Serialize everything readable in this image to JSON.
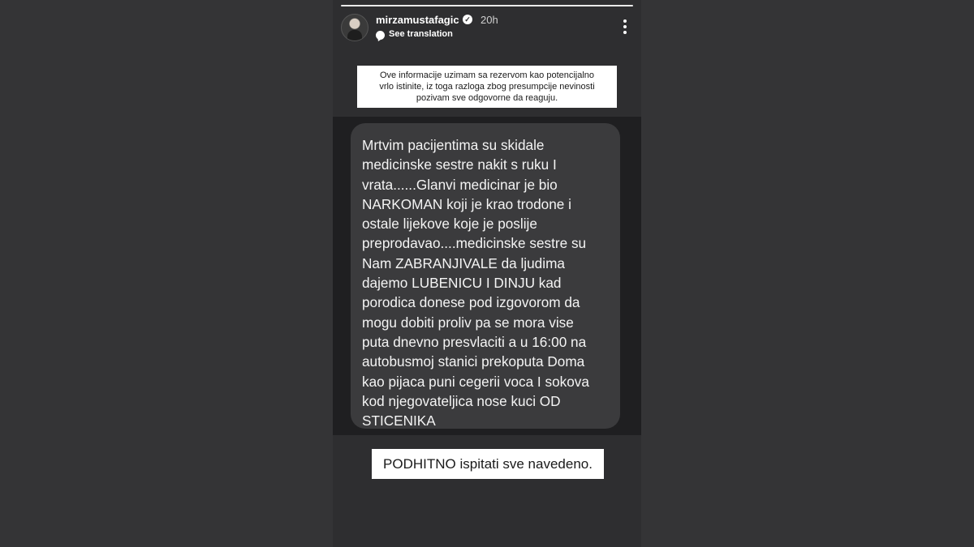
{
  "story": {
    "segments": 1,
    "username": "mirzamustafagic",
    "verified_icon": "verified-badge-icon",
    "time": "20h",
    "see_translation": "See translation",
    "more_icon": "more-options-icon"
  },
  "caption": {
    "lines": [
      "Ove informacije uzimam sa rezervom kao potencijalno",
      "vrlo istinite, iz toga razloga zbog presumpcije nevinosti",
      "pozivam sve odgovorne da reaguju."
    ]
  },
  "message": {
    "lines": [
      "Mrtvim pacijentima su skidale",
      "medicinske sestre nakit s ruku I",
      "vrata......Glanvi medicinar je bio",
      "NARKOMAN koji je krao trodone i",
      "ostale lijekove koje je poslije",
      "preprodavao....medicinske sestre su",
      "Nam ZABRANJIVALE da ljudima",
      "dajemo LUBENICU I DINJU kad",
      "porodica donese pod izgovorom da",
      "mogu dobiti proliv pa se mora vise",
      "puta dnevno presvlaciti a u 16:00 na",
      "autobusmoj stanici prekoputa Doma",
      "kao pijaca puni cegerii voca I sokova",
      "kod njegovateljica nose kuci OD",
      "STICENIKA"
    ]
  },
  "bottom_text": "PODHITNO ispitati sve navedeno."
}
